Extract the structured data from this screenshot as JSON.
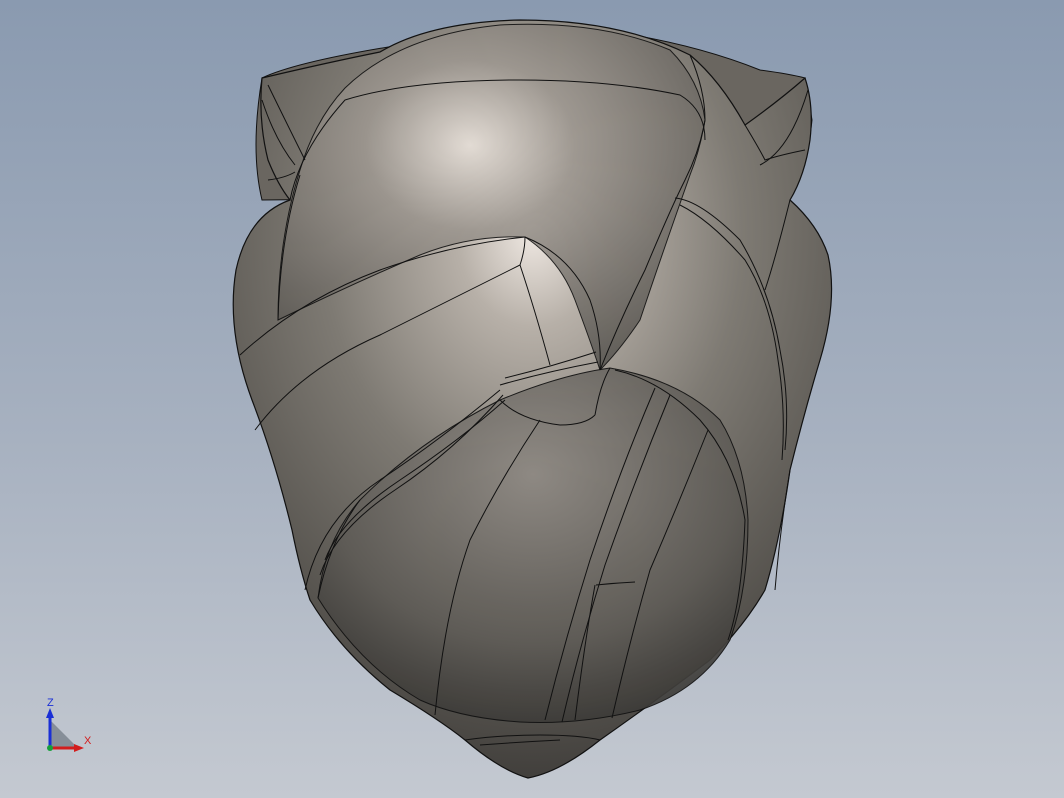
{
  "triad": {
    "z_label": "Z",
    "x_label": "X",
    "z_color": "#1a2fd6",
    "x_color": "#d21d1d",
    "origin_color": "#17a03a"
  },
  "model": {
    "surface_color": "#6e6b65",
    "highlight_color": "#ece6e0",
    "edge_color": "#111111"
  }
}
